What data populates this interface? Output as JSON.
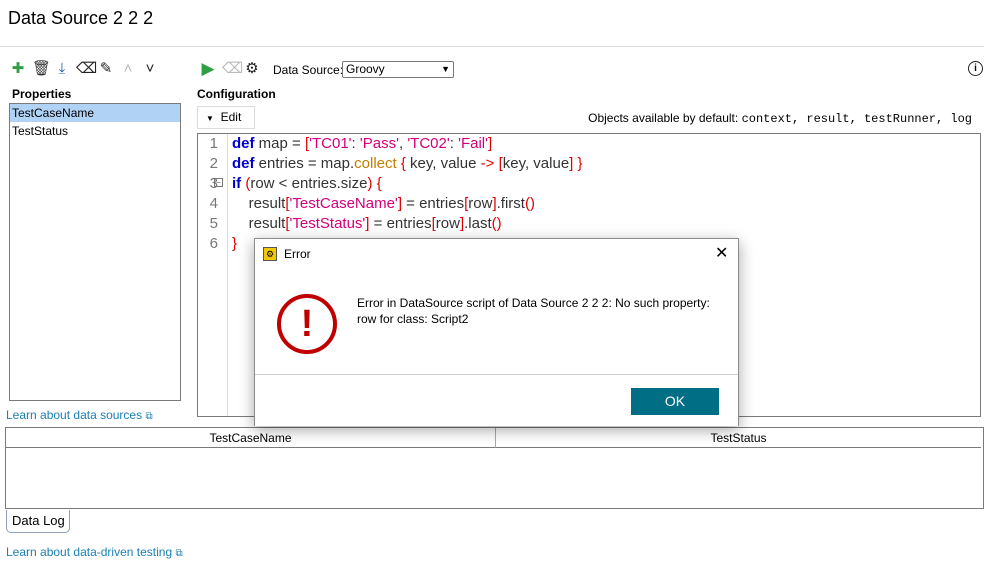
{
  "window": {
    "title": "Data Source 2 2 2"
  },
  "toolbar_left": [
    {
      "icon": "plus-icon",
      "glyph": "✚",
      "color": "#2ea043"
    },
    {
      "icon": "trash-icon",
      "glyph": "🗑",
      "color": "#333"
    },
    {
      "icon": "download-icon",
      "glyph": "⤓",
      "color": "#1f5fa8"
    },
    {
      "icon": "eraser-icon",
      "glyph": "⌫",
      "color": "#222"
    },
    {
      "icon": "pencil-icon",
      "glyph": "✎",
      "color": "#222"
    },
    {
      "icon": "chevron-up-icon",
      "glyph": "˄",
      "color": "#bbb"
    },
    {
      "icon": "chevron-down-icon",
      "glyph": "˅",
      "color": "#222"
    }
  ],
  "toolbar_right": {
    "data_source_label": "Data Source:",
    "data_source_value": "Groovy"
  },
  "properties": {
    "label": "Properties",
    "items": [
      "TestCaseName",
      "TestStatus"
    ],
    "selected": 0
  },
  "configuration": {
    "label": "Configuration",
    "edit_label": "Edit",
    "objects_prefix": "Objects available by default:",
    "objects": "context, result, testRunner, log"
  },
  "code_lines": [
    [
      [
        "def",
        "kw"
      ],
      [
        " map = ",
        "op"
      ],
      [
        "[",
        "br"
      ],
      [
        "'TC01'",
        "str"
      ],
      [
        ": ",
        "op"
      ],
      [
        "'Pass'",
        "str"
      ],
      [
        ", ",
        "op"
      ],
      [
        "'TC02'",
        "str"
      ],
      [
        ": ",
        "op"
      ],
      [
        "'Fail'",
        "str"
      ],
      [
        "]",
        "br"
      ]
    ],
    [
      [
        "def",
        "kw"
      ],
      [
        " entries = map.",
        "op"
      ],
      [
        "collect",
        "fn"
      ],
      [
        " ",
        "op"
      ],
      [
        "{",
        "br"
      ],
      [
        " key, value ",
        "op"
      ],
      [
        "->",
        "br"
      ],
      [
        " ",
        "op"
      ],
      [
        "[",
        "br"
      ],
      [
        "key, value",
        "op"
      ],
      [
        "]",
        "br"
      ],
      [
        " ",
        "op"
      ],
      [
        "}",
        "br"
      ]
    ],
    [
      [
        "if",
        "kw"
      ],
      [
        " ",
        "op"
      ],
      [
        "(",
        "br"
      ],
      [
        "row < entries.size",
        "op"
      ],
      [
        ")",
        "br"
      ],
      [
        " ",
        "op"
      ],
      [
        "{",
        "br"
      ]
    ],
    [
      [
        "    result",
        "op"
      ],
      [
        "[",
        "br"
      ],
      [
        "'TestCaseName'",
        "str"
      ],
      [
        "]",
        "br"
      ],
      [
        " = entries",
        "op"
      ],
      [
        "[",
        "br"
      ],
      [
        "row",
        "op"
      ],
      [
        "]",
        "br"
      ],
      [
        ".first",
        "op"
      ],
      [
        "()",
        "br"
      ]
    ],
    [
      [
        "    result",
        "op"
      ],
      [
        "[",
        "br"
      ],
      [
        "'TestStatus'",
        "str"
      ],
      [
        "]",
        "br"
      ],
      [
        " = entries",
        "op"
      ],
      [
        "[",
        "br"
      ],
      [
        "row",
        "op"
      ],
      [
        "]",
        "br"
      ],
      [
        ".last",
        "op"
      ],
      [
        "()",
        "br"
      ]
    ],
    [
      [
        "}",
        "br"
      ]
    ]
  ],
  "links": {
    "data_sources": "Learn about data sources",
    "data_driven": "Learn about data-driven testing"
  },
  "table": {
    "columns": [
      "TestCaseName",
      "TestStatus"
    ]
  },
  "tabs": {
    "data_log": "Data Log"
  },
  "dialog": {
    "title": "Error",
    "message_line1": "Error in DataSource script of Data Source 2 2 2: No such property:",
    "message_line2": "row for class: Script2",
    "ok_label": "OK"
  },
  "colors": {
    "accent": "#006e85",
    "error": "#c00000",
    "link": "#1a7fb5",
    "selection": "#b0d3f5"
  }
}
